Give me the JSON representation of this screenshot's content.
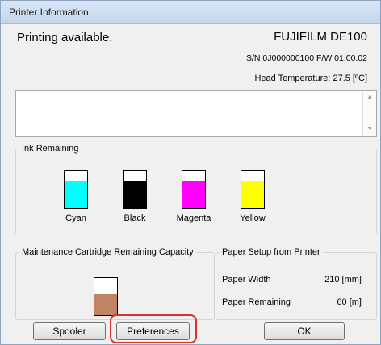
{
  "window": {
    "title": "Printer Information"
  },
  "status": {
    "message": "Printing available.",
    "model": "FUJIFILM DE100",
    "serial_fw": "S/N 0J000000100  F/W 01.00.02",
    "head_temperature": "Head Temperature: 27.5 [ºC]"
  },
  "scroll": {
    "up_icon": "▲",
    "down_icon": "▼"
  },
  "ink": {
    "legend": "Ink Remaining",
    "items": [
      {
        "label": "Cyan",
        "color": "#00ffff",
        "level": 0.74
      },
      {
        "label": "Black",
        "color": "#000000",
        "level": 0.74
      },
      {
        "label": "Magenta",
        "color": "#ff00ff",
        "level": 0.74
      },
      {
        "label": "Yellow",
        "color": "#ffff00",
        "level": 0.74
      }
    ]
  },
  "maintenance": {
    "legend": "Maintenance Cartridge Remaining Capacity",
    "fill_color": "#c08463",
    "level": 0.56
  },
  "paper": {
    "legend": "Paper Setup from Printer",
    "width_label": "Paper Width",
    "width_value": "210 [mm]",
    "remaining_label": "Paper Remaining",
    "remaining_value": "60 [m]"
  },
  "buttons": {
    "spooler": "Spooler",
    "preferences": "Preferences",
    "ok": "OK"
  },
  "highlight_color": "#d5312f"
}
